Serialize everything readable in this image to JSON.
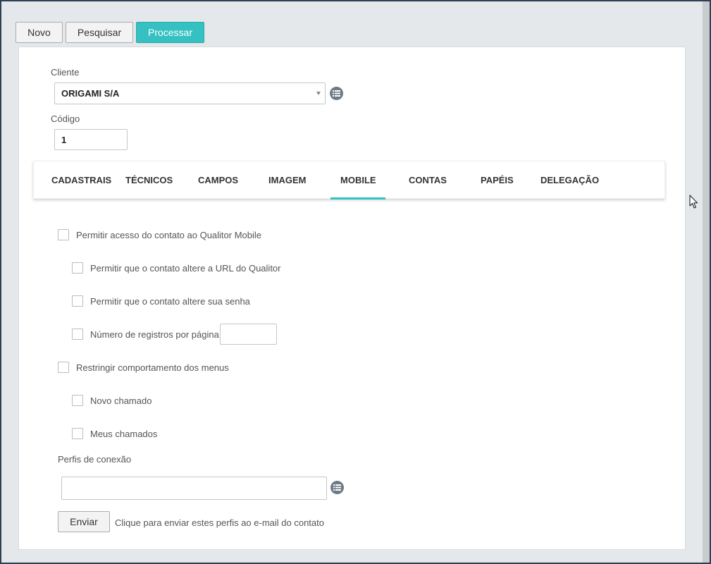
{
  "toolbar": {
    "novo_label": "Novo",
    "pesquisar_label": "Pesquisar",
    "processar_label": "Processar"
  },
  "form": {
    "cliente_label": "Cliente",
    "cliente_value": "ORIGAMI S/A",
    "codigo_label": "Código",
    "codigo_value": "1"
  },
  "tabs": [
    {
      "label": "CADASTRAIS"
    },
    {
      "label": "TÉCNICOS"
    },
    {
      "label": "CAMPOS"
    },
    {
      "label": "IMAGEM"
    },
    {
      "label": "MOBILE",
      "active": true
    },
    {
      "label": "CONTAS"
    },
    {
      "label": "PAPÉIS"
    },
    {
      "label": "DELEGAÇÃO"
    }
  ],
  "mobile": {
    "permitir_acesso": "Permitir acesso do contato ao Qualitor Mobile",
    "alterar_url": "Permitir que o contato altere a URL do Qualitor",
    "alterar_senha": "Permitir que o contato altere sua senha",
    "registros_por_pagina": "Número de registros por página",
    "registros_value": "",
    "restringir_menus": "Restringir comportamento dos menus",
    "novo_chamado": "Novo chamado",
    "meus_chamados": "Meus chamados",
    "perfis_label": "Perfis de conexão",
    "perfis_value": "",
    "enviar_label": "Enviar",
    "enviar_hint": "Clique para enviar estes perfis ao e-mail do contato"
  },
  "colors": {
    "accent": "#35c1c1",
    "frame": "#2e3f55"
  },
  "icons": [
    "list-icon",
    "caret-down-icon",
    "mouse-cursor-icon"
  ]
}
